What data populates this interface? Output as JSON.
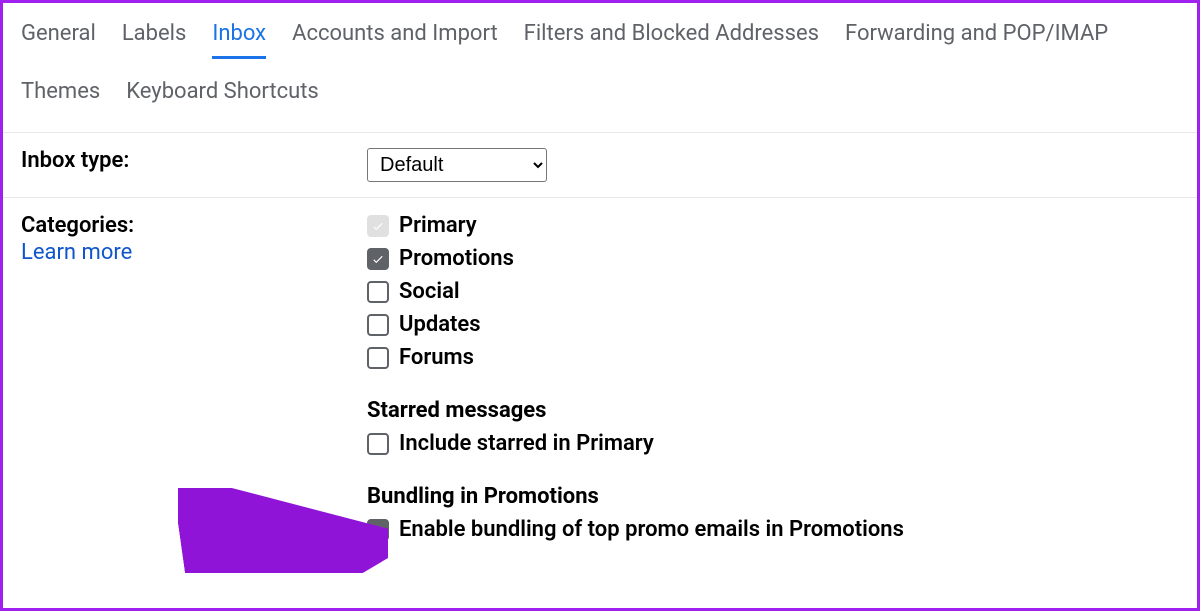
{
  "tabs": [
    {
      "label": "General",
      "active": false
    },
    {
      "label": "Labels",
      "active": false
    },
    {
      "label": "Inbox",
      "active": true
    },
    {
      "label": "Accounts and Import",
      "active": false
    },
    {
      "label": "Filters and Blocked Addresses",
      "active": false
    },
    {
      "label": "Forwarding and POP/IMAP",
      "active": false
    },
    {
      "label": "Themes",
      "active": false
    },
    {
      "label": "Keyboard Shortcuts",
      "active": false
    }
  ],
  "inboxType": {
    "label": "Inbox type:",
    "selected": "Default"
  },
  "categories": {
    "label": "Categories:",
    "learnMore": "Learn more",
    "items": [
      {
        "label": "Primary",
        "state": "checked-disabled"
      },
      {
        "label": "Promotions",
        "state": "checked"
      },
      {
        "label": "Social",
        "state": "unchecked"
      },
      {
        "label": "Updates",
        "state": "unchecked"
      },
      {
        "label": "Forums",
        "state": "unchecked"
      }
    ],
    "starred": {
      "heading": "Starred messages",
      "item": {
        "label": "Include starred in Primary",
        "state": "unchecked"
      }
    },
    "bundling": {
      "heading": "Bundling in Promotions",
      "item": {
        "label": "Enable bundling of top promo emails in Promotions",
        "state": "checked"
      }
    }
  }
}
